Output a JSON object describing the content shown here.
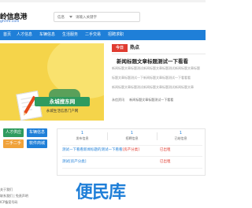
{
  "header": {
    "logo_main": "岭信息港",
    "logo_sub": "ghrmr.com",
    "search_select": "信息",
    "search_placeholder": "请输入关键字"
  },
  "nav": [
    "首页",
    "人才信息",
    "车辆信息",
    "生活服务",
    "二手交易",
    "招聘求职"
  ],
  "banner": {
    "title": "永城搜东网",
    "subtitle": "永城生活信息门户网"
  },
  "headlines": {
    "today_badge": "今日",
    "hot_label": "热点",
    "title": "新闻标题文章标题测试一下看看",
    "lines": [
      "新闻标题文章标题测试新闻标题文章标题测试新闻标题文章标题",
      "标题文章标题测试一下新闻标题文章标题测试一下看看看",
      "新闻标题文章标题测试新闻标题文章标题测试新闻标题文章"
    ],
    "meta_source": "永信资讯",
    "meta_text": "新闻标题文章标题测试一下看看"
  },
  "quick_links": [
    "人才供应",
    "车辆信息",
    "二手二手",
    "软件商城"
  ],
  "stats": [
    {
      "num": "1",
      "label": "发布信息"
    },
    {
      "num": "1",
      "label": "招聘信息"
    },
    {
      "num": "1",
      "label": "已结信息"
    }
  ],
  "rows": [
    {
      "title": "测试一下看看新闻标题的测试一下看看",
      "category": "[房产分类]",
      "status": "已出租"
    },
    {
      "title": "测试[房产分类]",
      "category": "",
      "status": "已出租"
    }
  ],
  "footer": {
    "lines": [
      "关于我们",
      "联系我们 | 免责声明",
      "ICP备案号码"
    ]
  },
  "watermark": "便民库",
  "colors": {
    "brand": "#1f7fd8",
    "accent": "#e03c31",
    "banner": "#f5d44a"
  }
}
